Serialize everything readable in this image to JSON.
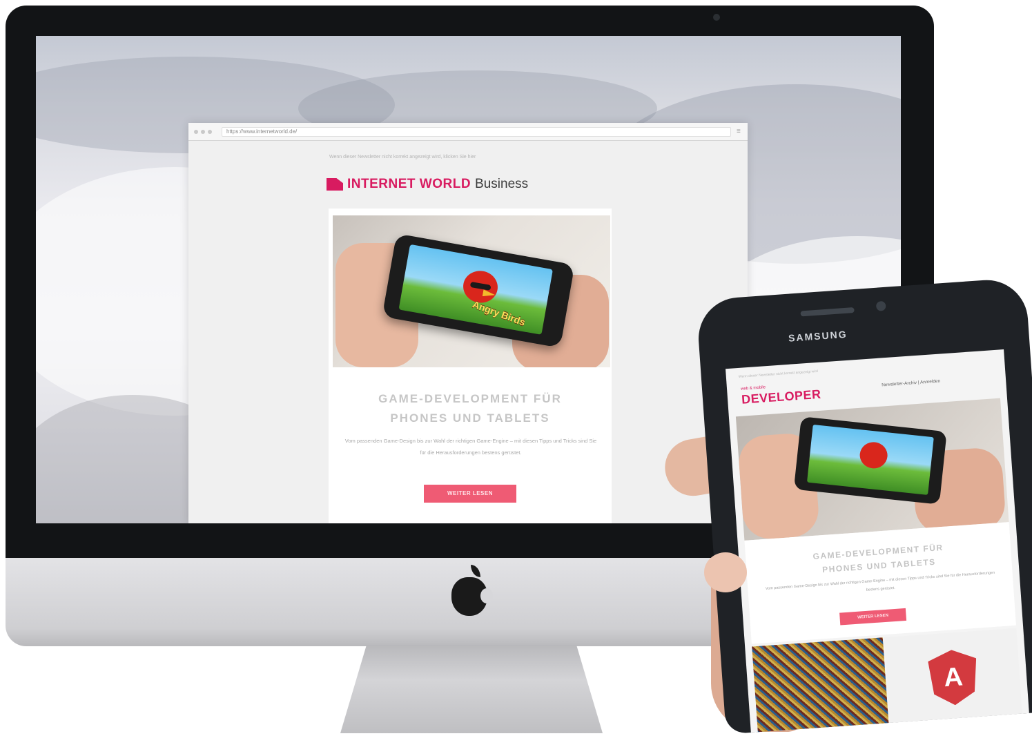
{
  "imac": {
    "logo_icon": "apple-logo-icon",
    "browser": {
      "url": "https://www.internetworld.de/",
      "menu_icon": "hamburger-menu-icon"
    },
    "newsletter": {
      "preheader": "Wenn dieser Newsletter nicht korrekt angezeigt wird, klicken Sie hier",
      "brand_name": "INTERNET WORLD",
      "brand_suffix": "Business",
      "hero_game_title": "Angry Birds",
      "headline_line1": "GAME-DEVELOPMENT FÜR",
      "headline_line2": "PHONES UND TABLETS",
      "body": "Vom passenden Game-Design bis zur Wahl der richtigen Game-Engine – mit diesen Tipps und Tricks sind Sie für die Herausforderungen bestens gerüstet.",
      "cta_label": "WEITER LESEN"
    }
  },
  "phone": {
    "brand": "SAMSUNG",
    "newsletter": {
      "preheader": "Wenn dieser Newsletter nicht korrekt angezeigt wird",
      "brand_small": "web & mobile",
      "brand_name": "DEVELOPER",
      "nav": "Newsletter-Archiv | Anmelden",
      "headline_line1": "GAME-DEVELOPMENT FÜR",
      "headline_line2": "PHONES UND TABLETS",
      "body": "Vom passenden Game-Design bis zur Wahl der richtigen Game-Engine – mit diesen Tipps und Tricks sind Sie für die Herausforderungen bestens gerüstet.",
      "cta_label": "WEITER LESEN",
      "tile_logo_letter": "A"
    }
  },
  "colors": {
    "brand_magenta": "#d81b60",
    "cta_pink": "#ef5b74",
    "bezel": "#121416"
  }
}
